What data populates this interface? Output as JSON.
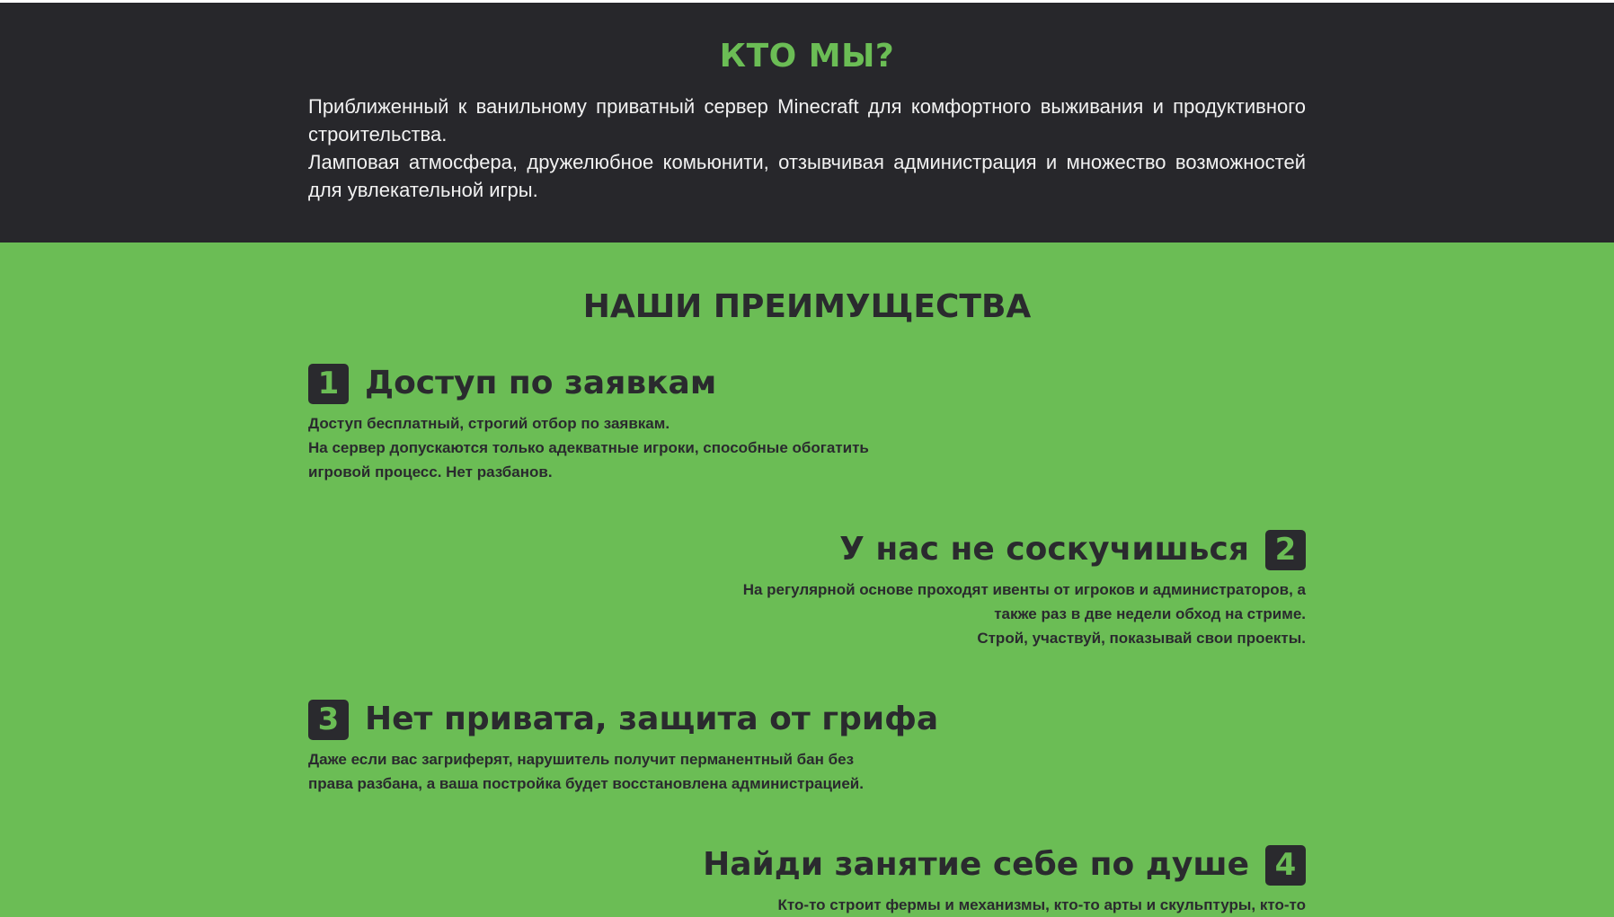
{
  "about": {
    "title": "КТО МЫ?",
    "paragraph1": "Приближенный к ванильному приватный сервер Minecraft для комфортного выживания и продуктивного строительства.",
    "paragraph2": "Ламповая атмосфера, дружелюбное комьюнити, отзывчивая администрация и множество возможностей для увлекательной игры."
  },
  "features": {
    "title": "НАШИ ПРЕИМУЩЕСТВА",
    "items": [
      {
        "number": "1",
        "title": "Доступ по заявкам",
        "lines": [
          "Доступ бесплатный, строгий отбор по заявкам.",
          "На сервер допускаются только адекватные игроки, способные обогатить игровой процесс. Нет разбанов."
        ]
      },
      {
        "number": "2",
        "title": "У нас не соскучишься",
        "lines": [
          "На регулярной основе проходят ивенты от игроков и администраторов, а также раз в две недели обход на стриме.",
          "Строй, участвуй, показывай свои проекты."
        ]
      },
      {
        "number": "3",
        "title": "Нет привата, защита от грифа",
        "lines": [
          "Даже если вас загриферят, нарушитель получит перманентный бан без права разбана, а ваша постройка будет восстановлена администрацией."
        ]
      },
      {
        "number": "4",
        "title": "Найди занятие себе по душе",
        "lines": [
          "Кто-то строит фермы и механизмы, кто-то арты и скульптуры, кто-то"
        ]
      }
    ]
  }
}
